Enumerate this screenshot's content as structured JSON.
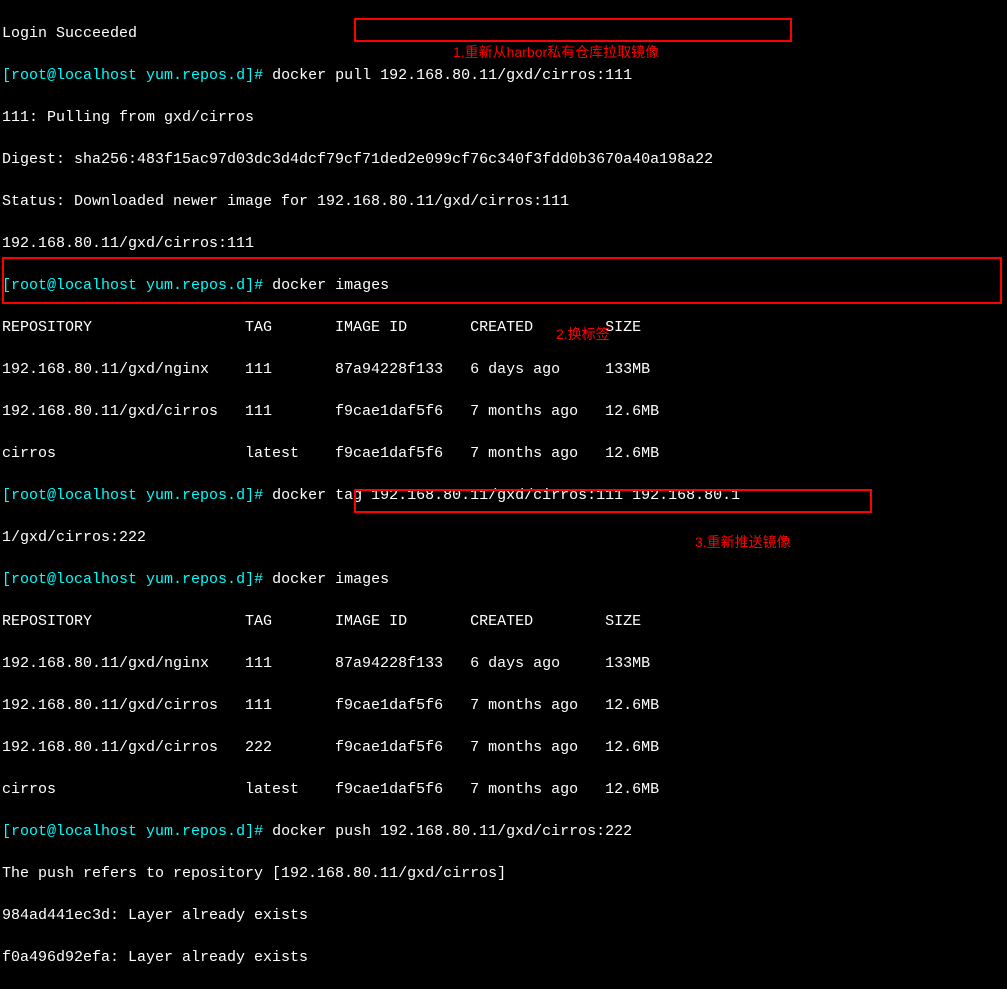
{
  "lines": {
    "l0": "Login Succeeded",
    "p1_open": "[",
    "p1_user": "root@localhost",
    "p1_path": " yum.repos.d",
    "p1_close": "]# ",
    "c1": "docker pull 192.168.80.11/gxd/cirros:111",
    "l2": "111: Pulling from gxd/cirros",
    "l3": "Digest: sha256:483f15ac97d03dc3d4dcf79cf71ded2e099cf76c340f3fdd0b3670a40a198a22",
    "l4": "Status: Downloaded newer image for 192.168.80.11/gxd/cirros:111",
    "l5": "192.168.80.11/gxd/cirros:111",
    "p2_open": "[",
    "p2_user": "root@localhost",
    "p2_path": " yum.repos.d",
    "p2_close": "]# ",
    "c2": "docker images",
    "h1": "REPOSITORY                 TAG       IMAGE ID       CREATED        SIZE",
    "r1_1": "192.168.80.11/gxd/nginx    111       87a94228f133   6 days ago     133MB",
    "r1_2": "192.168.80.11/gxd/cirros   111       f9cae1daf5f6   7 months ago   12.6MB",
    "r1_3": "cirros                     latest    f9cae1daf5f6   7 months ago   12.6MB",
    "p3_open": "[",
    "p3_user": "root@localhost",
    "p3_path": " yum.repos.d",
    "p3_close": "]# ",
    "c3": "docker tag 192.168.80.11/gxd/cirros:111 192.168.80.1",
    "l11": "1/gxd/cirros:222",
    "p4_open": "[",
    "p4_user": "root@localhost",
    "p4_path": " yum.repos.d",
    "p4_close": "]# ",
    "c4": "docker images",
    "h2": "REPOSITORY                 TAG       IMAGE ID       CREATED        SIZE",
    "r2_1": "192.168.80.11/gxd/nginx    111       87a94228f133   6 days ago     133MB",
    "r2_2": "192.168.80.11/gxd/cirros   111       f9cae1daf5f6   7 months ago   12.6MB",
    "r2_3": "192.168.80.11/gxd/cirros   222       f9cae1daf5f6   7 months ago   12.6MB",
    "r2_4": "cirros                     latest    f9cae1daf5f6   7 months ago   12.6MB",
    "p5_open": "[",
    "p5_user": "root@localhost",
    "p5_path": " yum.repos.d",
    "p5_close": "]# ",
    "c5": "docker push 192.168.80.11/gxd/cirros:222",
    "l19": "The push refers to repository [192.168.80.11/gxd/cirros]",
    "l20": "984ad441ec3d: Layer already exists",
    "l21": "f0a496d92efa: Layer already exists"
  },
  "annotations": {
    "a1": "1.重新从harbor私有仓库拉取镜像",
    "a2": "2.换标签",
    "a3": "3.重新推送镜像"
  }
}
